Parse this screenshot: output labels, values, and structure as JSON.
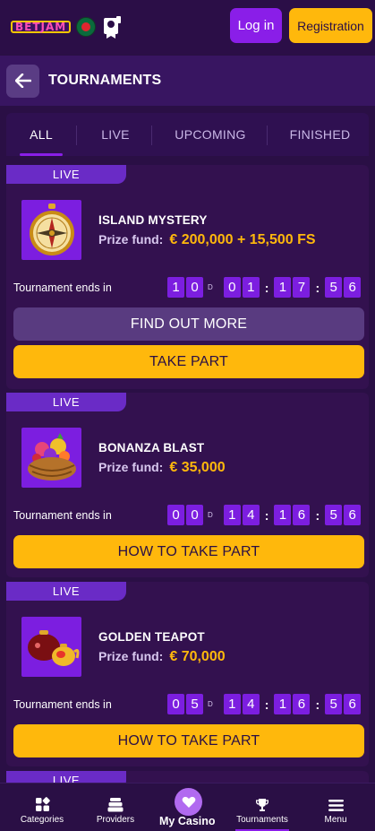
{
  "header": {
    "logo_text": "BETJAM",
    "flag_icon": "bangladesh-flag-icon",
    "promo_icon": "reward-badge-icon",
    "login_label": "Log in",
    "register_label": "Registration"
  },
  "title_bar": {
    "back_icon": "arrow-left-icon",
    "title": "TOURNAMENTS"
  },
  "tabs": [
    {
      "label": "ALL",
      "active": true
    },
    {
      "label": "LIVE",
      "active": false
    },
    {
      "label": "UPCOMING",
      "active": false
    },
    {
      "label": "FINISHED",
      "active": false
    }
  ],
  "tournaments": [
    {
      "status": "LIVE",
      "name": "ISLAND MYSTERY",
      "thumb_icon": "compass-icon",
      "prize_label": "Prize fund:",
      "prize_value": "€ 200,000 + 15,500 FS",
      "ends_label": "Tournament ends in",
      "days": [
        "1",
        "0"
      ],
      "day_unit": "D",
      "hours": [
        "0",
        "1"
      ],
      "minutes": [
        "1",
        "7"
      ],
      "seconds": [
        "5",
        "6"
      ],
      "more_label": "FIND OUT MORE",
      "action_label": "TAKE PART"
    },
    {
      "status": "LIVE",
      "name": "BONANZA BLAST",
      "thumb_icon": "fruit-basket-icon",
      "prize_label": "Prize fund:",
      "prize_value": "€ 35,000",
      "ends_label": "Tournament ends in",
      "days": [
        "0",
        "0"
      ],
      "day_unit": "D",
      "hours": [
        "1",
        "4"
      ],
      "minutes": [
        "1",
        "6"
      ],
      "seconds": [
        "5",
        "6"
      ],
      "action_label": "HOW TO TAKE PART"
    },
    {
      "status": "LIVE",
      "name": "GOLDEN TEAPOT",
      "thumb_icon": "teapot-icon",
      "prize_label": "Prize fund:",
      "prize_value": "€ 70,000",
      "ends_label": "Tournament ends in",
      "days": [
        "0",
        "5"
      ],
      "day_unit": "D",
      "hours": [
        "1",
        "4"
      ],
      "minutes": [
        "1",
        "6"
      ],
      "seconds": [
        "5",
        "6"
      ],
      "action_label": "HOW TO TAKE PART"
    },
    {
      "status": "LIVE"
    }
  ],
  "bottom_nav": [
    {
      "label": "Categories",
      "icon": "grid-icon"
    },
    {
      "label": "Providers",
      "icon": "stack-icon"
    },
    {
      "label": "My Casino",
      "icon": "heart-icon"
    },
    {
      "label": "Tournaments",
      "icon": "trophy-icon",
      "active": true
    },
    {
      "label": "Menu",
      "icon": "hamburger-icon"
    }
  ]
}
